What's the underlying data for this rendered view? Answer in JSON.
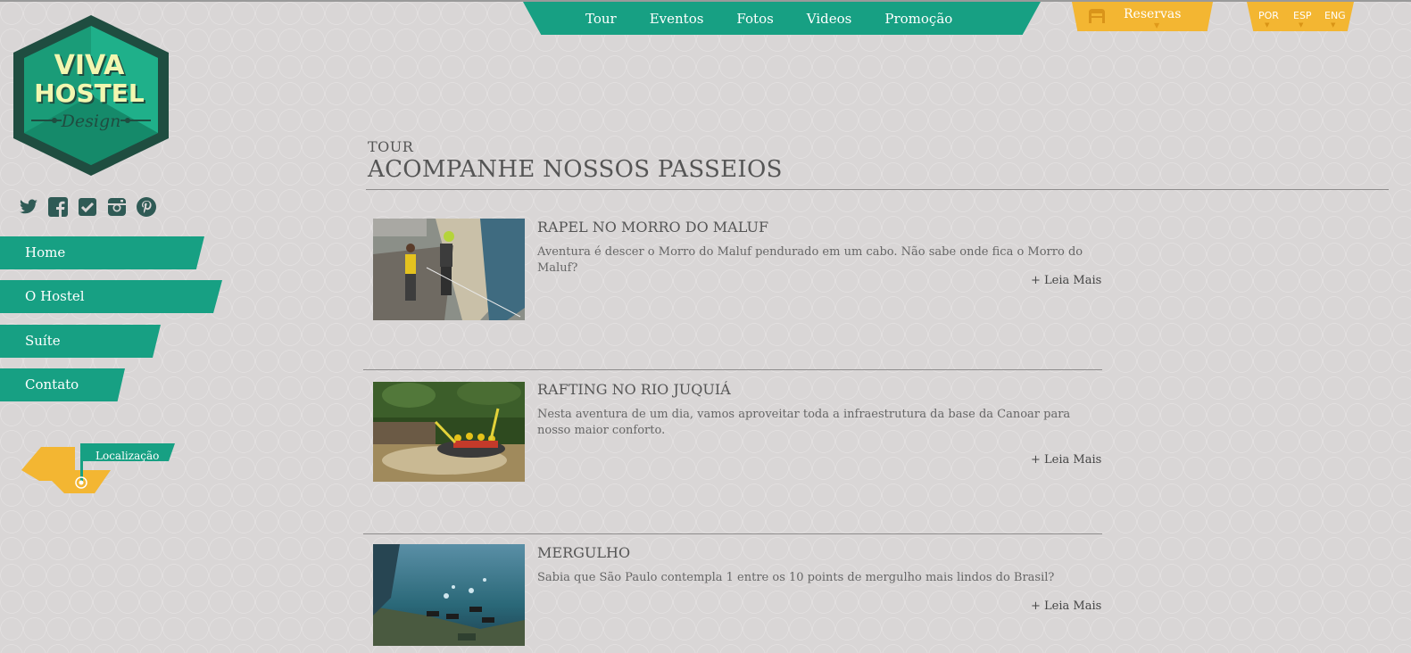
{
  "colors": {
    "accent_green": "#17a083",
    "accent_yellow": "#f3b632",
    "background": "#d9d6d6"
  },
  "topnav": {
    "items": [
      "Tour",
      "Eventos",
      "Fotos",
      "Videos",
      "Promoção"
    ]
  },
  "reservas": {
    "label": "Reservas",
    "icon": "bed-icon"
  },
  "languages": [
    "POR",
    "ESP",
    "ENG"
  ],
  "logo": {
    "line1": "VIVA",
    "line2": "HOSTEL",
    "line3": "Design"
  },
  "social": [
    "twitter-icon",
    "facebook-icon",
    "foursquare-icon",
    "instagram-icon",
    "pinterest-icon"
  ],
  "sidebar": {
    "items": [
      {
        "label": "Home"
      },
      {
        "label": "O Hostel"
      },
      {
        "label": "Suíte"
      },
      {
        "label": "Contato"
      }
    ]
  },
  "location": {
    "label": "Localização"
  },
  "section": {
    "kicker": "TOUR",
    "title": "ACOMPANHE NOSSOS PASSEIOS"
  },
  "tours": [
    {
      "title": "RAPEL NO MORRO DO MALUF",
      "text": "Aventura é descer o Morro do Maluf pendurado em um cabo. Não sabe onde fica o Morro do Maluf?",
      "more": "+ Leia Mais"
    },
    {
      "title": "RAFTING NO RIO JUQUIÁ",
      "text": "Nesta aventura de um dia, vamos aproveitar toda a infraestrutura da base da Canoar para nosso maior conforto.",
      "more": "+ Leia Mais"
    },
    {
      "title": "MERGULHO",
      "text": "Sabia que São Paulo contempla 1 entre os 10 points de mergulho mais lindos do Brasil?",
      "more": "+ Leia Mais"
    }
  ]
}
